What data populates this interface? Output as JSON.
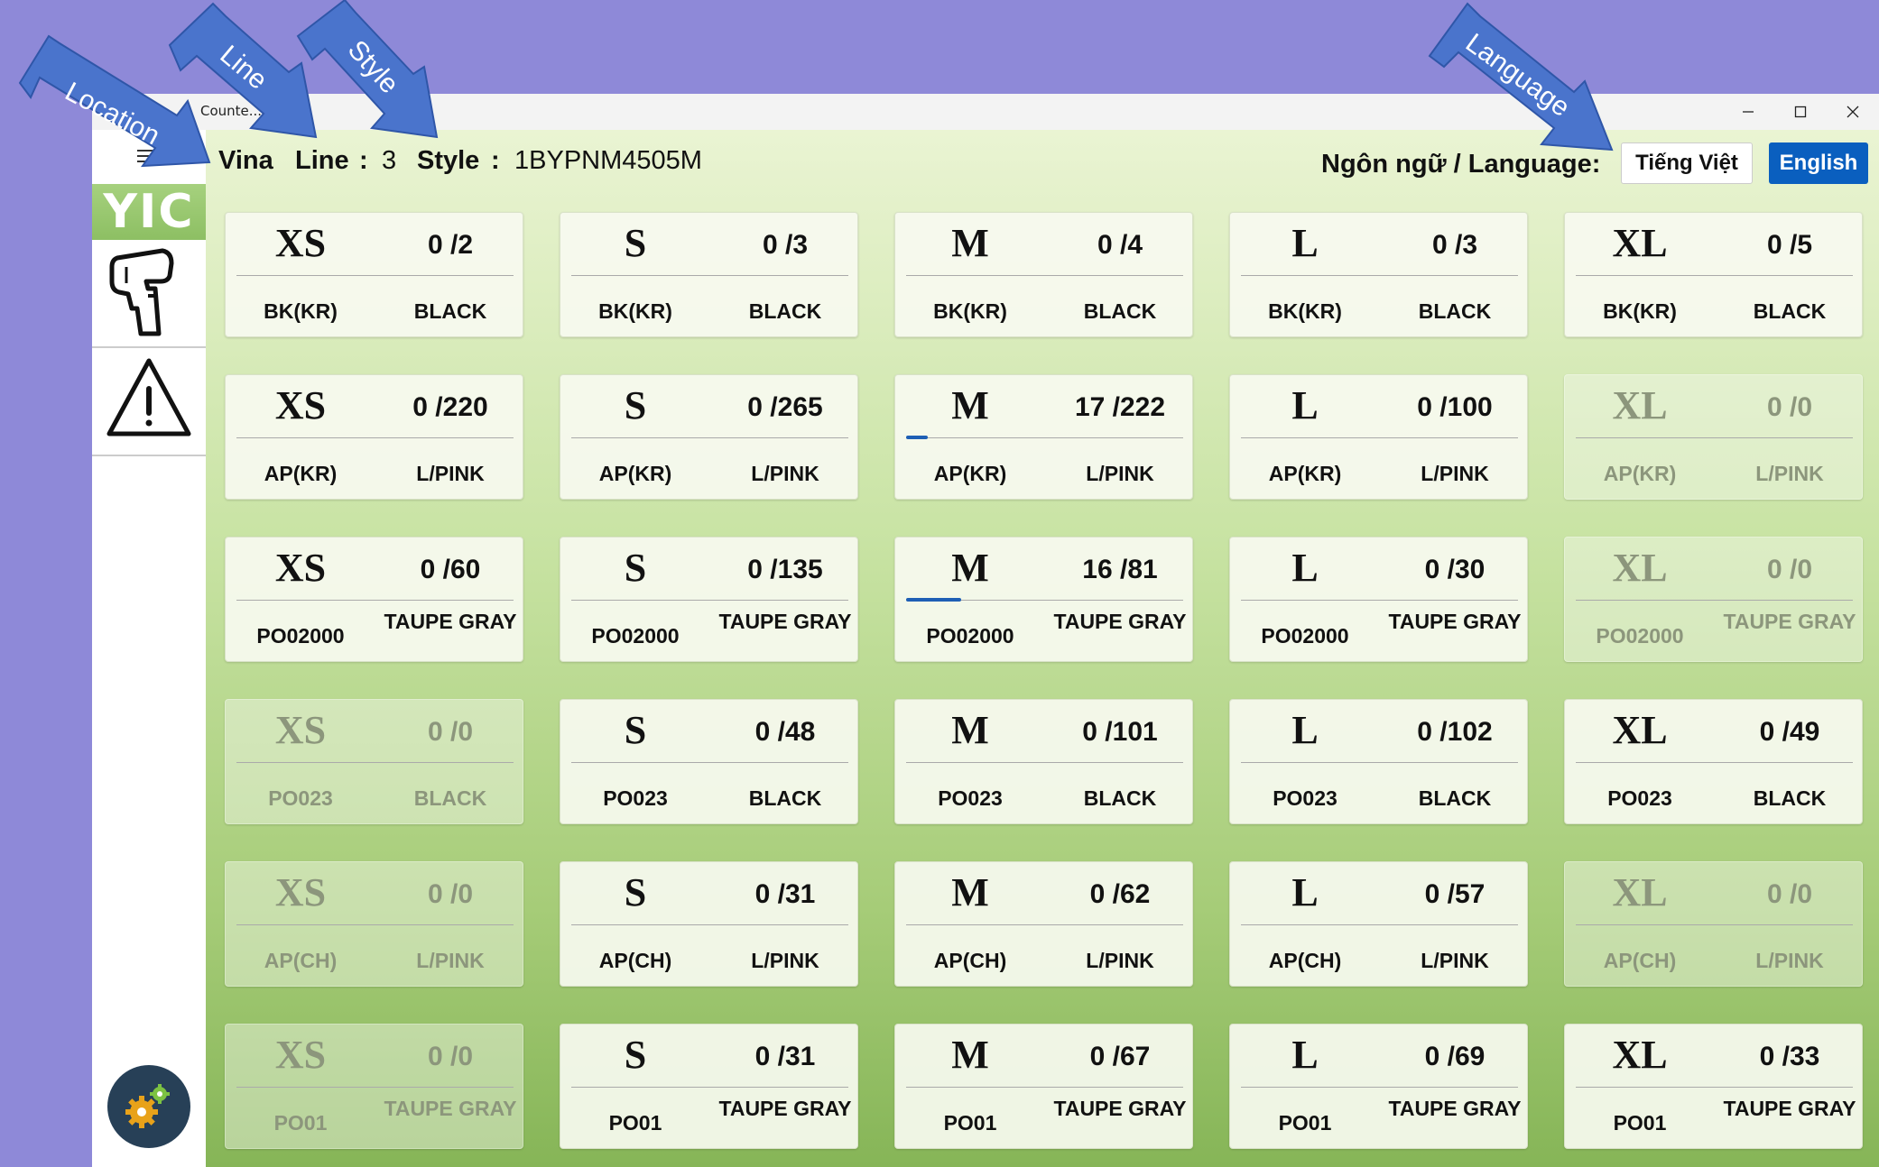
{
  "window": {
    "title": "Counte..."
  },
  "header": {
    "location": "Vina",
    "line_label": "Line",
    "line_value": "3",
    "style_label": "Style",
    "style_value": "1BYPNM4505M",
    "sep": ":",
    "language_label": "Ngôn ngữ / Language:",
    "lang_vi": "Tiếng Việt",
    "lang_en": "English"
  },
  "sidebar": {
    "logo": "YIC"
  },
  "callouts": {
    "location": "Location",
    "line": "Line",
    "style": "Style",
    "language": "Language"
  },
  "colors": {
    "accent": "#0a5fbf",
    "progress": "#1e5fb5",
    "sidebar_settings": "#274057"
  },
  "cards": [
    {
      "size": "XS",
      "count": "0 /2",
      "code": "BK(KR)",
      "color": "BLACK",
      "dim": false,
      "progress": 0
    },
    {
      "size": "S",
      "count": "0 /3",
      "code": "BK(KR)",
      "color": "BLACK",
      "dim": false,
      "progress": 0
    },
    {
      "size": "M",
      "count": "0 /4",
      "code": "BK(KR)",
      "color": "BLACK",
      "dim": false,
      "progress": 0
    },
    {
      "size": "L",
      "count": "0 /3",
      "code": "BK(KR)",
      "color": "BLACK",
      "dim": false,
      "progress": 0
    },
    {
      "size": "XL",
      "count": "0 /5",
      "code": "BK(KR)",
      "color": "BLACK",
      "dim": false,
      "progress": 0
    },
    {
      "size": "XS",
      "count": "0 /220",
      "code": "AP(KR)",
      "color": "L/PINK",
      "dim": false,
      "progress": 0
    },
    {
      "size": "S",
      "count": "0 /265",
      "code": "AP(KR)",
      "color": "L/PINK",
      "dim": false,
      "progress": 0
    },
    {
      "size": "M",
      "count": "17 /222",
      "code": "AP(KR)",
      "color": "L/PINK",
      "dim": false,
      "progress": 0.077
    },
    {
      "size": "L",
      "count": "0 /100",
      "code": "AP(KR)",
      "color": "L/PINK",
      "dim": false,
      "progress": 0
    },
    {
      "size": "XL",
      "count": "0 /0",
      "code": "AP(KR)",
      "color": "L/PINK",
      "dim": true,
      "progress": 0
    },
    {
      "size": "XS",
      "count": "0 /60",
      "code": "PO02000",
      "color": "TAUPE GRAY",
      "dim": false,
      "progress": 0
    },
    {
      "size": "S",
      "count": "0 /135",
      "code": "PO02000",
      "color": "TAUPE GRAY",
      "dim": false,
      "progress": 0
    },
    {
      "size": "M",
      "count": "16 /81",
      "code": "PO02000",
      "color": "TAUPE GRAY",
      "dim": false,
      "progress": 0.198
    },
    {
      "size": "L",
      "count": "0 /30",
      "code": "PO02000",
      "color": "TAUPE GRAY",
      "dim": false,
      "progress": 0
    },
    {
      "size": "XL",
      "count": "0 /0",
      "code": "PO02000",
      "color": "TAUPE GRAY",
      "dim": true,
      "progress": 0
    },
    {
      "size": "XS",
      "count": "0 /0",
      "code": "PO023",
      "color": "BLACK",
      "dim": true,
      "progress": 0
    },
    {
      "size": "S",
      "count": "0 /48",
      "code": "PO023",
      "color": "BLACK",
      "dim": false,
      "progress": 0
    },
    {
      "size": "M",
      "count": "0 /101",
      "code": "PO023",
      "color": "BLACK",
      "dim": false,
      "progress": 0
    },
    {
      "size": "L",
      "count": "0 /102",
      "code": "PO023",
      "color": "BLACK",
      "dim": false,
      "progress": 0
    },
    {
      "size": "XL",
      "count": "0 /49",
      "code": "PO023",
      "color": "BLACK",
      "dim": false,
      "progress": 0
    },
    {
      "size": "XS",
      "count": "0 /0",
      "code": "AP(CH)",
      "color": "L/PINK",
      "dim": true,
      "progress": 0
    },
    {
      "size": "S",
      "count": "0 /31",
      "code": "AP(CH)",
      "color": "L/PINK",
      "dim": false,
      "progress": 0
    },
    {
      "size": "M",
      "count": "0 /62",
      "code": "AP(CH)",
      "color": "L/PINK",
      "dim": false,
      "progress": 0
    },
    {
      "size": "L",
      "count": "0 /57",
      "code": "AP(CH)",
      "color": "L/PINK",
      "dim": false,
      "progress": 0
    },
    {
      "size": "XL",
      "count": "0 /0",
      "code": "AP(CH)",
      "color": "L/PINK",
      "dim": true,
      "progress": 0
    },
    {
      "size": "XS",
      "count": "0 /0",
      "code": "PO01",
      "color": "TAUPE GRAY",
      "dim": true,
      "progress": 0
    },
    {
      "size": "S",
      "count": "0 /31",
      "code": "PO01",
      "color": "TAUPE GRAY",
      "dim": false,
      "progress": 0
    },
    {
      "size": "M",
      "count": "0 /67",
      "code": "PO01",
      "color": "TAUPE GRAY",
      "dim": false,
      "progress": 0
    },
    {
      "size": "L",
      "count": "0 /69",
      "code": "PO01",
      "color": "TAUPE GRAY",
      "dim": false,
      "progress": 0
    },
    {
      "size": "XL",
      "count": "0 /33",
      "code": "PO01",
      "color": "TAUPE GRAY",
      "dim": false,
      "progress": 0
    }
  ]
}
